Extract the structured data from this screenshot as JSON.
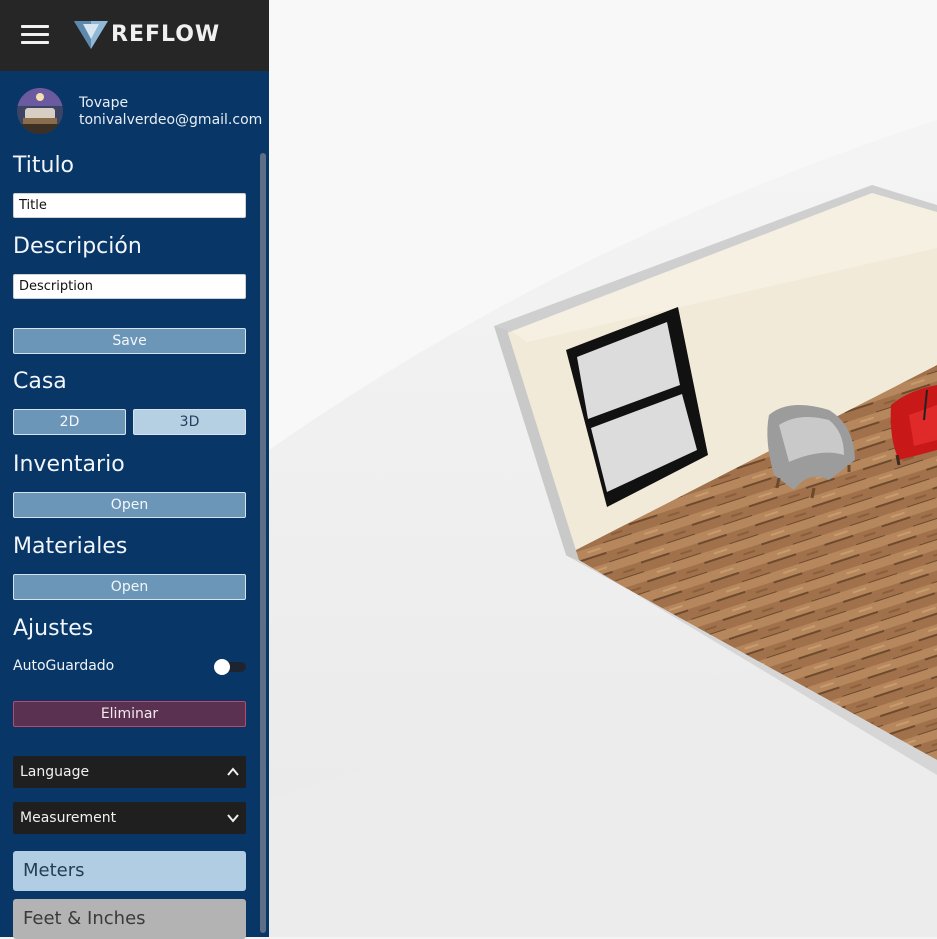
{
  "app": {
    "logo_text": "REFLOW",
    "menu_icon": "hamburger-icon",
    "logo_icon": "reflow-logo-icon"
  },
  "user": {
    "name": "Tovape",
    "email": "tonivalverdeo@gmail.com"
  },
  "title_section": {
    "heading": "Titulo",
    "value": "Title"
  },
  "description_section": {
    "heading": "Descripción",
    "value": "Description"
  },
  "save_label": "Save",
  "casa": {
    "heading": "Casa",
    "btn_2d": "2D",
    "btn_3d": "3D"
  },
  "inventario": {
    "heading": "Inventario",
    "open_label": "Open"
  },
  "materiales": {
    "heading": "Materiales",
    "open_label": "Open"
  },
  "ajustes": {
    "heading": "Ajustes",
    "autosave_label": "AutoGuardado",
    "autosave_on": false
  },
  "delete_label": "Eliminar",
  "language": {
    "label": "Language",
    "expanded": false
  },
  "measurement": {
    "label": "Measurement",
    "expanded": true,
    "options": [
      "Meters",
      "Feet & Inches"
    ],
    "selected": "Meters"
  },
  "colors": {
    "sidebar_bg": "#083667",
    "topbar_bg": "#262626",
    "button_bg": "#6b96b8",
    "danger_bg": "#5b3152"
  }
}
